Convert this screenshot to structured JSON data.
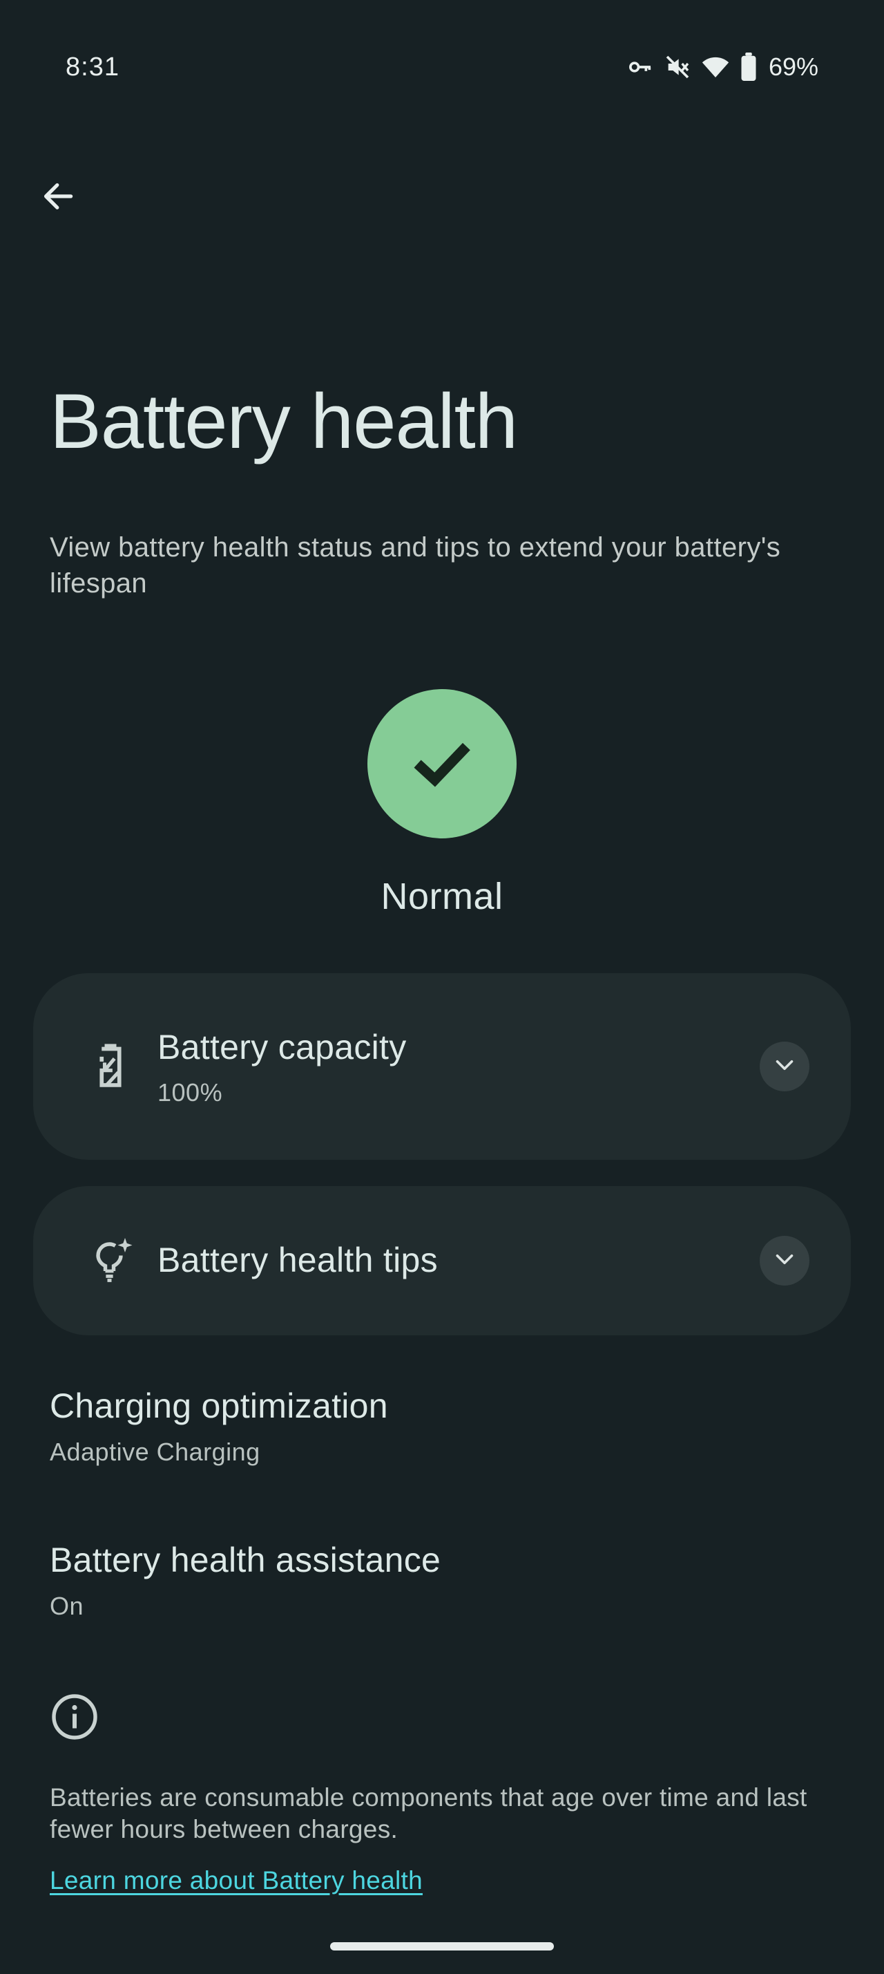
{
  "status_bar": {
    "time": "8:31",
    "battery_percent": "69%",
    "icons": [
      "vpn-key-icon",
      "mute-icon",
      "wifi-icon",
      "battery-icon"
    ]
  },
  "header": {
    "back_icon": "arrow-back-icon",
    "title": "Battery health",
    "description": "View battery health status and tips to extend your battery's lifespan"
  },
  "health_status": {
    "icon": "check-icon",
    "label": "Normal",
    "color": "#85cc96"
  },
  "cards": {
    "capacity": {
      "icon": "battery-swap-icon",
      "title": "Battery capacity",
      "value": "100%",
      "expand_icon": "chevron-down-icon"
    },
    "tips": {
      "icon": "lightbulb-sparkle-icon",
      "title": "Battery health tips",
      "expand_icon": "chevron-down-icon"
    }
  },
  "settings": [
    {
      "title": "Charging optimization",
      "summary": "Adaptive Charging"
    },
    {
      "title": "Battery health assistance",
      "summary": "On"
    }
  ],
  "footer": {
    "info_icon": "info-icon",
    "text": "Batteries are consumable components that age over time and last fewer hours between charges.",
    "link": "Learn more about Battery health",
    "link_color": "#4dd6e0"
  },
  "colors": {
    "background": "#172124",
    "card": "#212c2e",
    "accent_green": "#85cc96"
  }
}
